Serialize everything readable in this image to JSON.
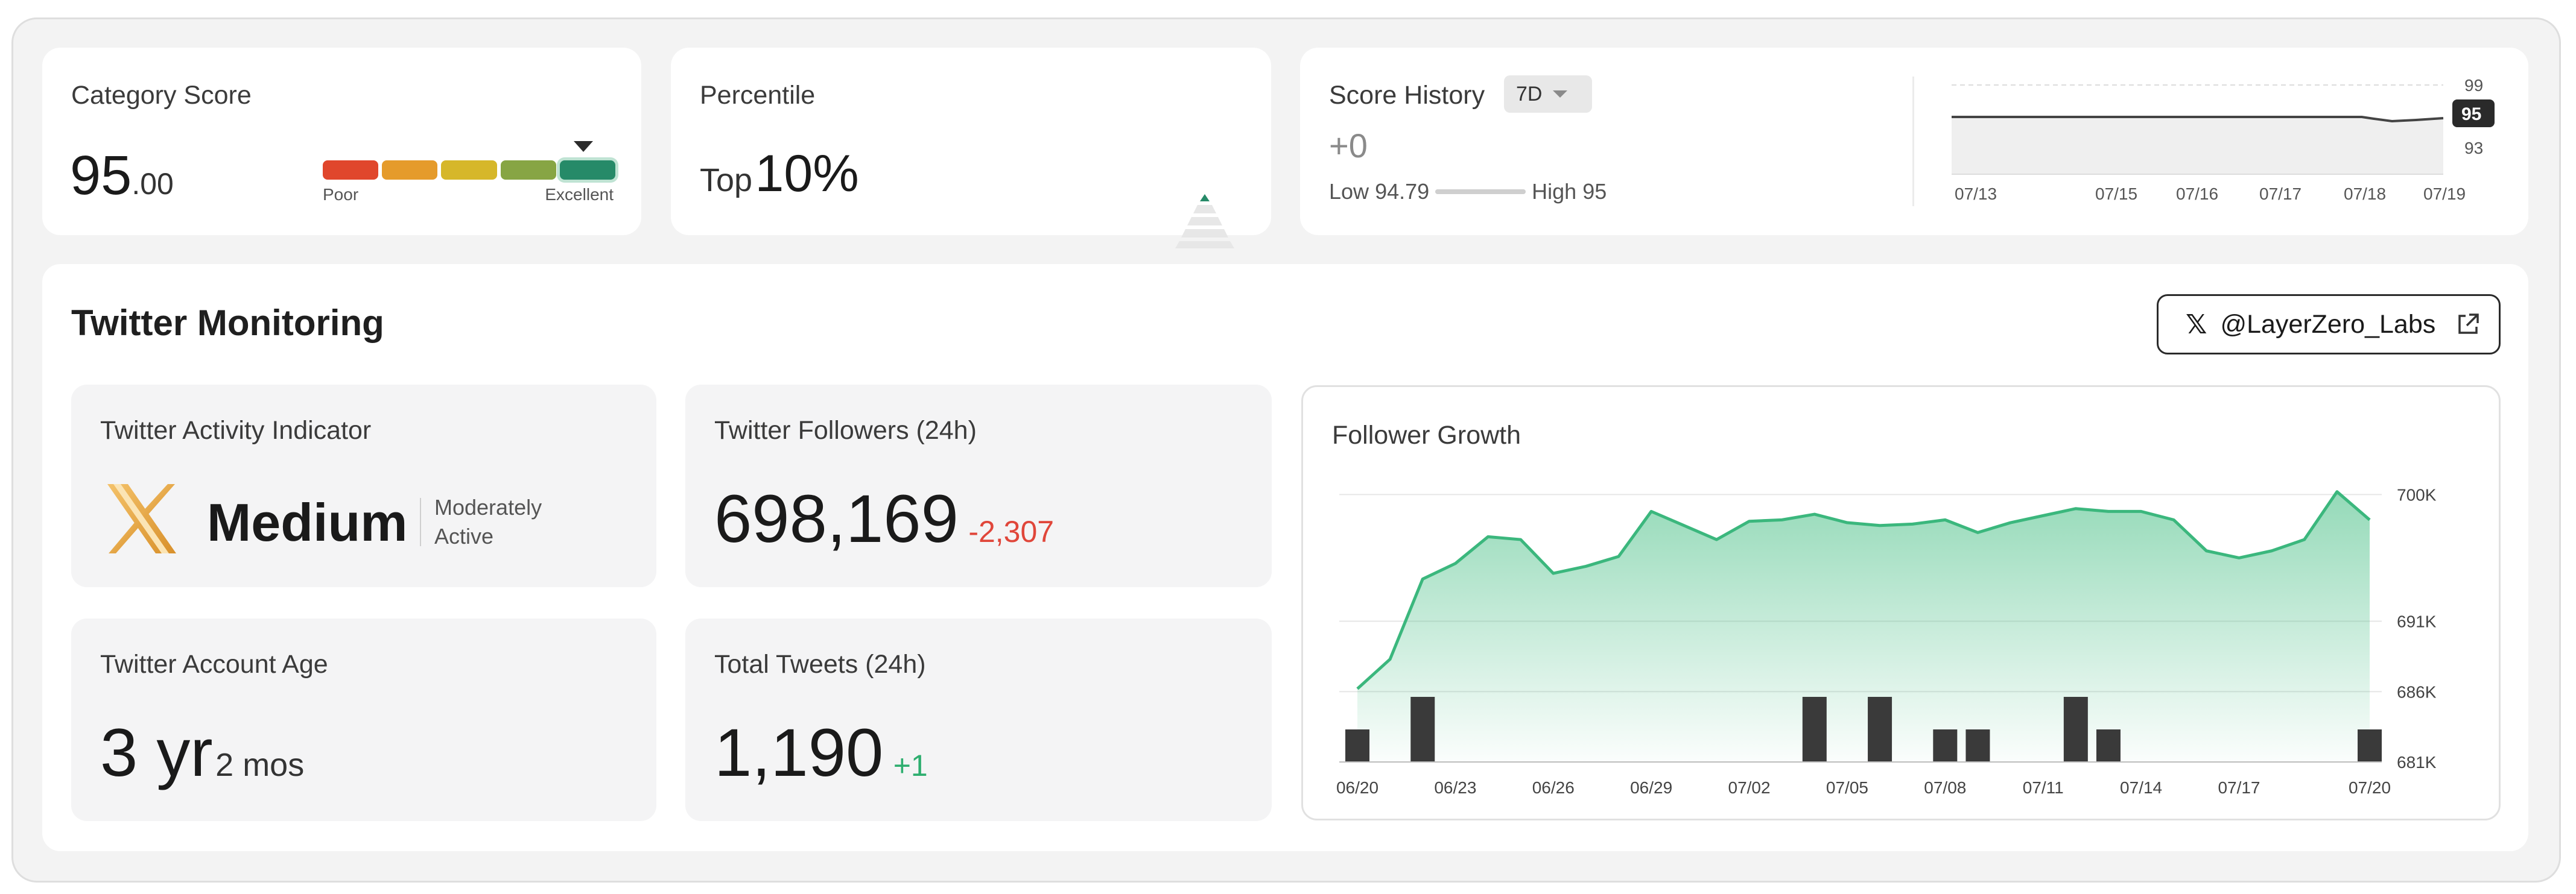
{
  "category_score": {
    "label": "Category Score",
    "value_int": "95",
    "value_dec": ".00",
    "scale_low": "Poor",
    "scale_high": "Excellent",
    "scale_colors": [
      "#e0462c",
      "#e59b2b",
      "#d6b72a",
      "#87a544",
      "#268a68"
    ],
    "active_segment": 5
  },
  "percentile": {
    "label": "Percentile",
    "prefix": "Top",
    "value": "10%"
  },
  "score_history": {
    "label": "Score History",
    "period": "7D",
    "change": "+0",
    "low_label": "Low",
    "low_value": "94.79",
    "high_label": "High",
    "high_value": "95",
    "y_top": "99",
    "y_mid": "95",
    "y_bottom": "93",
    "x_labels": [
      "07/13",
      "07/15",
      "07/16",
      "07/17",
      "07/18",
      "07/19"
    ]
  },
  "twitter": {
    "section_title": "Twitter Monitoring",
    "handle": "@LayerZero_Labs",
    "activity": {
      "label": "Twitter Activity Indicator",
      "level": "Medium",
      "desc_line1": "Moderately",
      "desc_line2": "Active"
    },
    "followers": {
      "label": "Twitter Followers (24h)",
      "value": "698,169",
      "change": "-2,307"
    },
    "age": {
      "label": "Twitter Account Age",
      "years": "3 yr",
      "months": "2 mos"
    },
    "tweets": {
      "label": "Total Tweets (24h)",
      "value": "1,190",
      "change": "+1"
    }
  },
  "chart_data": {
    "type": "area",
    "title": "Follower Growth",
    "x_tick_labels": [
      "06/20",
      "06/23",
      "06/26",
      "06/29",
      "07/02",
      "07/05",
      "07/08",
      "07/11",
      "07/14",
      "07/17",
      "07/20"
    ],
    "y_tick_labels": [
      "700K",
      "691K",
      "686K",
      "681K"
    ],
    "y_ticks": [
      700,
      691,
      686,
      681
    ],
    "ylim": [
      681,
      701
    ],
    "series": [
      {
        "type": "area",
        "values": [
          686.2,
          688.3,
          694.0,
          695.1,
          697.0,
          696.8,
          694.4,
          694.9,
          695.6,
          698.8,
          697.8,
          696.8,
          698.1,
          698.2,
          698.6,
          698.0,
          697.8,
          697.9,
          698.2,
          697.3,
          698.0,
          698.5,
          699.0,
          698.8,
          698.8,
          698.2,
          696.0,
          695.5,
          696.0,
          696.8,
          700.2,
          698.2
        ]
      },
      {
        "type": "bar",
        "values": [
          2.5,
          0,
          5,
          0,
          0,
          0,
          0,
          0,
          0,
          0,
          0,
          0,
          0,
          0,
          5,
          0,
          5,
          0,
          2.5,
          2.5,
          0,
          0,
          5,
          2.5,
          0,
          0,
          0,
          0,
          0,
          0,
          0,
          2.5
        ]
      }
    ],
    "grid": true
  }
}
